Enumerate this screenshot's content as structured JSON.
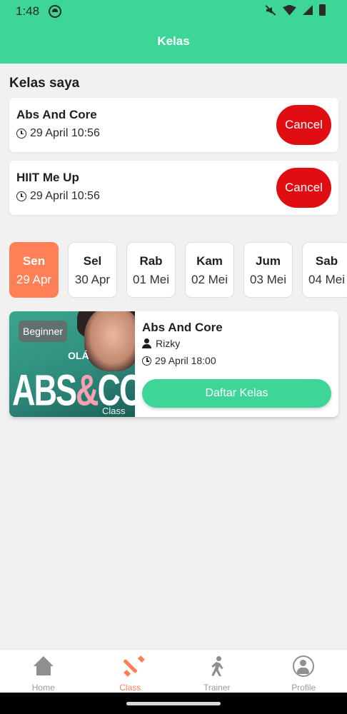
{
  "status_bar": {
    "time": "1:48"
  },
  "header": {
    "title": "Kelas"
  },
  "my_classes": {
    "title": "Kelas saya",
    "items": [
      {
        "name": "Abs And Core",
        "datetime": "29 April 10:56",
        "cancel_label": "Cancel"
      },
      {
        "name": "HIIT Me Up",
        "datetime": "29 April 10:56",
        "cancel_label": "Cancel"
      }
    ]
  },
  "days": [
    {
      "day": "Sen",
      "date": "29 Apr",
      "selected": true
    },
    {
      "day": "Sel",
      "date": "30 Apr",
      "selected": false
    },
    {
      "day": "Rab",
      "date": "01 Mei",
      "selected": false
    },
    {
      "day": "Kam",
      "date": "02 Mei",
      "selected": false
    },
    {
      "day": "Jum",
      "date": "03 Mei",
      "selected": false
    },
    {
      "day": "Sab",
      "date": "04 Mei",
      "selected": false
    }
  ],
  "class_card": {
    "badge": "Beginner",
    "name": "Abs And Core",
    "trainer": "Rizky",
    "datetime": "29 April 18:00",
    "register_label": "Daftar Kelas",
    "image": {
      "brand": "OLÁ",
      "word1": "ABS",
      "amp": "&",
      "word2": "CORE",
      "sub": "Class"
    }
  },
  "bottom_nav": {
    "items": [
      {
        "label": "Home",
        "icon": "home-icon"
      },
      {
        "label": "Class",
        "icon": "dumbbell-icon",
        "active": true
      },
      {
        "label": "Trainer",
        "icon": "running-icon"
      },
      {
        "label": "Profile",
        "icon": "profile-icon"
      }
    ]
  },
  "colors": {
    "primary": "#3ed599",
    "accent": "#ff7f57",
    "cancel": "#e00e12"
  }
}
